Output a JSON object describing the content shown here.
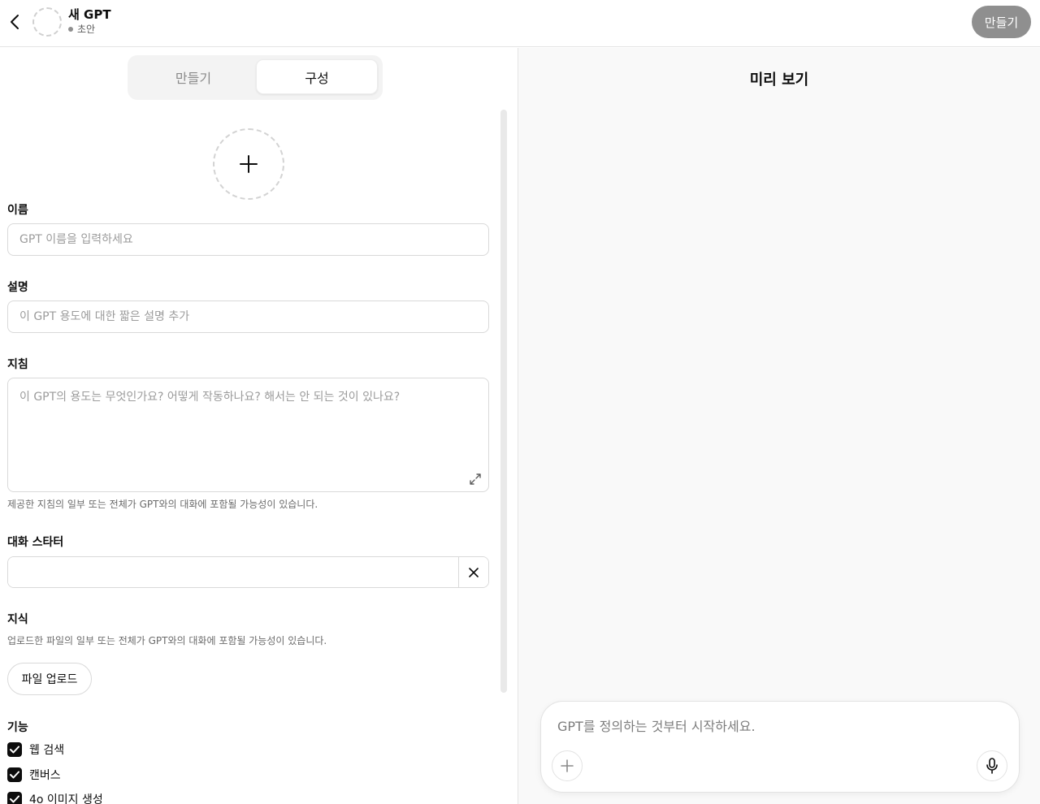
{
  "header": {
    "title": "새 GPT",
    "status": "초안",
    "create_label": "만들기"
  },
  "tabs": [
    {
      "label": "만들기"
    },
    {
      "label": "구성"
    }
  ],
  "form": {
    "name_label": "이름",
    "name_placeholder": "GPT 이름을 입력하세요",
    "description_label": "설명",
    "description_placeholder": "이 GPT 용도에 대한 짧은 설명 추가",
    "instructions_label": "지침",
    "instructions_placeholder": "이 GPT의 용도는 무엇인가요? 어떻게 작동하나요? 해서는 안 되는 것이 있나요?",
    "instructions_hint": "제공한 지침의 일부 또는 전체가 GPT와의 대화에 포함될 가능성이 있습니다.",
    "starters_label": "대화 스타터",
    "starter_value": "",
    "knowledge_label": "지식",
    "knowledge_hint": "업로드한 파일의 일부 또는 전체가 GPT와의 대화에 포함될 가능성이 있습니다.",
    "upload_label": "파일 업로드",
    "capabilities_label": "기능",
    "capabilities": [
      {
        "label": "웹 검색",
        "checked": true
      },
      {
        "label": "캔버스",
        "checked": true
      },
      {
        "label": "4o 이미지 생성",
        "checked": true
      }
    ]
  },
  "preview": {
    "title": "미리 보기",
    "composer_placeholder": "GPT를 정의하는 것부터 시작하세요."
  },
  "colors": {
    "accent_disabled": "#8f8f8f",
    "checkbox": "#0d0d0d",
    "preview_bg": "#f9f9f9"
  }
}
